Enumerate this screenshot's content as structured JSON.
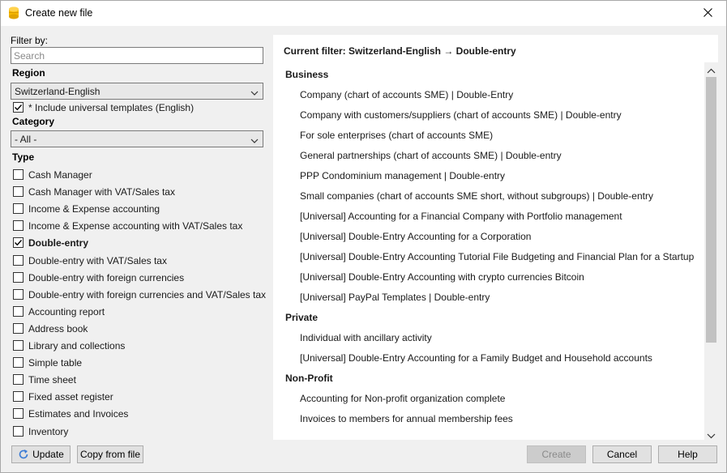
{
  "window": {
    "title": "Create new file"
  },
  "filter": {
    "label": "Filter by:",
    "search_placeholder": "Search",
    "search_value": ""
  },
  "region": {
    "label": "Region",
    "selected": "Switzerland-English",
    "include_universal_label": "* Include universal templates (English)",
    "include_universal_checked": true
  },
  "category": {
    "label": "Category",
    "selected": "- All -"
  },
  "type": {
    "label": "Type",
    "items": [
      {
        "label": "Cash Manager",
        "checked": false
      },
      {
        "label": "Cash Manager with VAT/Sales tax",
        "checked": false
      },
      {
        "label": "Income & Expense accounting",
        "checked": false
      },
      {
        "label": "Income & Expense accounting with VAT/Sales tax",
        "checked": false
      },
      {
        "label": "Double-entry",
        "checked": true
      },
      {
        "label": "Double-entry with VAT/Sales tax",
        "checked": false
      },
      {
        "label": "Double-entry with foreign currencies",
        "checked": false
      },
      {
        "label": "Double-entry with foreign currencies and VAT/Sales tax",
        "checked": false
      },
      {
        "label": "Accounting report",
        "checked": false
      },
      {
        "label": "Address book",
        "checked": false
      },
      {
        "label": "Library and collections",
        "checked": false
      },
      {
        "label": "Simple table",
        "checked": false
      },
      {
        "label": "Time sheet",
        "checked": false
      },
      {
        "label": "Fixed asset register",
        "checked": false
      },
      {
        "label": "Estimates and Invoices",
        "checked": false
      },
      {
        "label": "Inventory",
        "checked": false
      }
    ]
  },
  "buttons": {
    "update": "Update",
    "copy_from_file": "Copy from file",
    "create": "Create",
    "cancel": "Cancel",
    "help": "Help"
  },
  "templates": {
    "current_filter": "Current filter: Switzerland-English → Double-entry",
    "groups": [
      {
        "title": "Business",
        "items": [
          "Company (chart of accounts SME) | Double-Entry",
          "Company with customers/suppliers (chart of accounts SME) | Double-entry",
          "For sole enterprises (chart of accounts SME)",
          "General partnerships (chart of accounts SME) | Double-entry",
          "PPP Condominium management | Double-entry",
          "Small companies (chart of accounts SME short, without subgroups) | Double-entry",
          "[Universal] Accounting for a Financial Company with Portfolio management",
          "[Universal] Double-Entry Accounting for a Corporation",
          "[Universal] Double-Entry Accounting Tutorial File Budgeting and Financial Plan for a Startup",
          "[Universal] Double-Entry Accounting with crypto currencies Bitcoin",
          "[Universal] PayPal Templates | Double-entry"
        ]
      },
      {
        "title": "Private",
        "items": [
          "Individual with ancillary activity",
          "[Universal] Double-Entry Accounting for a Family Budget and Household accounts"
        ]
      },
      {
        "title": "Non-Profit",
        "items": [
          "Accounting for Non-profit organization complete",
          "Invoices to members for annual membership fees"
        ]
      }
    ]
  },
  "icons": {
    "app": "app-logo-icon",
    "close": "close-icon",
    "dropdown": "chevron-down-icon",
    "refresh": "refresh-icon",
    "checkmark": "checkmark-icon",
    "scroll_up": "scroll-up-icon",
    "scroll_down": "scroll-down-icon"
  },
  "colors": {
    "app_icon_yellow": "#f5b800",
    "dialog_bg": "#f0f0f0",
    "scrollbar_thumb": "#c2c2c2"
  }
}
